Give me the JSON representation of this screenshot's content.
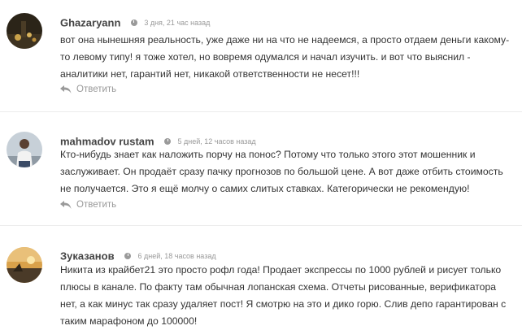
{
  "comments": [
    {
      "author": "Ghazaryann",
      "time": "3 дня, 21 час назад",
      "text": "вот она нынешняя реальность, уже даже ни на что не надеемся, а просто отдаем деньги какому-то левому типу! я тоже хотел, но вовремя одумался и начал изучить. и вот что выяснил - аналитики нет, гарантий нет, никакой ответственности не несет!!!",
      "reply_label": "Ответить",
      "avatar_icon": "avatar-photo-night-scene"
    },
    {
      "author": "mahmadov rustam",
      "time": "5 дней, 12 часов назад",
      "text": "Кто-нибудь знает как наложить порчу на понос? Потому что только этого этот мошенник и заслуживает. Он продаёт сразу пачку прогнозов по большой цене. А вот даже отбить стоимость не получается. Это я ещё молчу о самих слитых ставках. Категорически не рекомендую!",
      "reply_label": "Ответить",
      "avatar_icon": "avatar-photo-person"
    },
    {
      "author": "Зуказанов",
      "time": "6 дней, 18 часов назад",
      "text": "Никита из крайбет21 это просто рофл года! Продает экспрессы по 1000 рублей и рисует только плюсы в канале. По факту там обычная лопанская схема. Отчеты рисованные, верификатора нет, а как минус так сразу удаляет пост! Я смотрю на это и дико горю. Слив депо гарантирован с таким марафоном до 100000!",
      "reply_label": "",
      "avatar_icon": "avatar-photo-sunset"
    }
  ],
  "colors": {
    "author": "#444444",
    "meta": "#999999",
    "text": "#333333",
    "separator": "#ececec"
  }
}
